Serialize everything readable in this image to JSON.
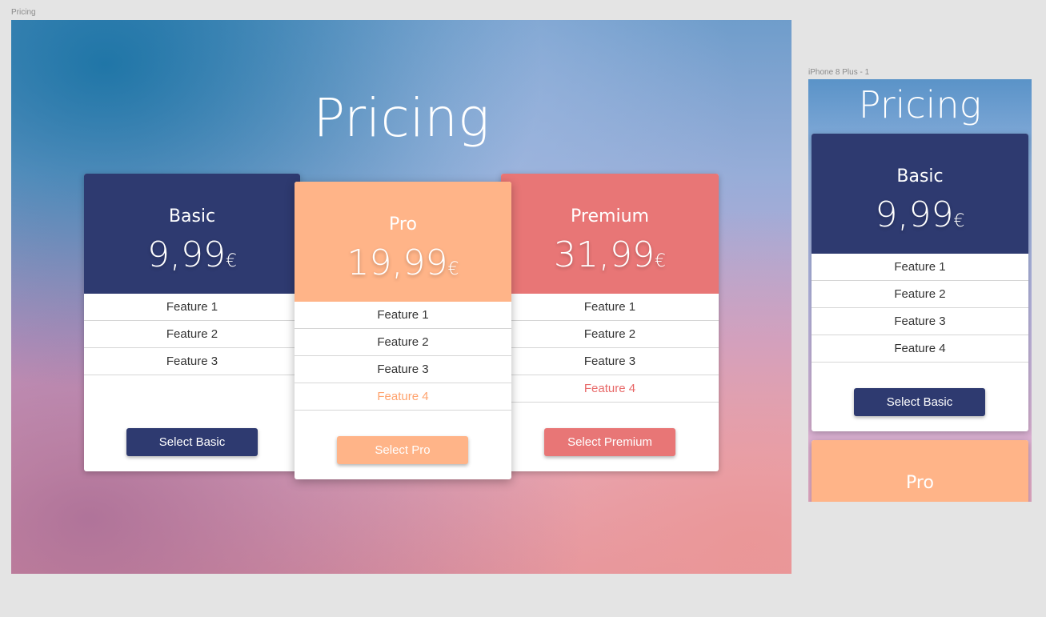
{
  "desktop": {
    "artboard_label": "Pricing",
    "title": "Pricing",
    "cards": {
      "basic": {
        "name": "Basic",
        "price": "9,99",
        "currency": "€",
        "features": [
          "Feature 1",
          "Feature 2",
          "Feature 3"
        ],
        "button": "Select Basic"
      },
      "pro": {
        "name": "Pro",
        "price": "19,99",
        "currency": "€",
        "features": [
          "Feature 1",
          "Feature 2",
          "Feature 3",
          "Feature 4"
        ],
        "button": "Select Pro"
      },
      "premium": {
        "name": "Premium",
        "price": "31,99",
        "currency": "€",
        "features": [
          "Feature 1",
          "Feature 2",
          "Feature 3",
          "Feature 4"
        ],
        "button": "Select Premium"
      }
    }
  },
  "mobile": {
    "artboard_label": "iPhone 8 Plus - 1",
    "title": "Pricing",
    "cards": {
      "basic": {
        "name": "Basic",
        "price": "9,99",
        "currency": "€",
        "features": [
          "Feature 1",
          "Feature 2",
          "Feature 3",
          "Feature 4"
        ],
        "button": "Select Basic"
      },
      "pro": {
        "name": "Pro"
      }
    }
  },
  "colors": {
    "basic": "#2e3a70",
    "pro": "#ffb488",
    "premium": "#e87676",
    "canvas": "#e4e4e4"
  }
}
